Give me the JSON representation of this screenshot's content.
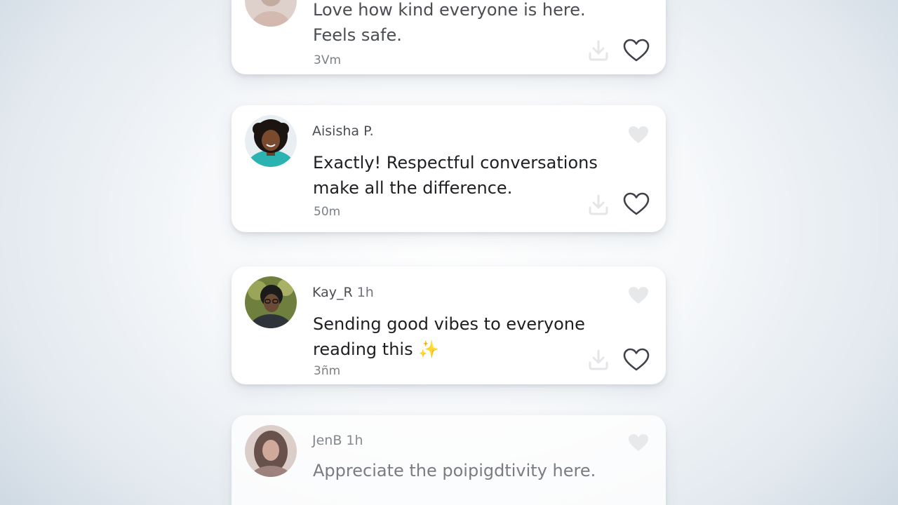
{
  "comments": [
    {
      "author": "",
      "time": "",
      "text": "Love how kind everyone is here.\nFeels safe.",
      "age": "3Vm"
    },
    {
      "author": "Aisisha P.",
      "time": "",
      "text": "Exactly! Respectful conversations\nmake all the difference.",
      "age": "50m"
    },
    {
      "author": "Kay_R",
      "time": "1h",
      "text": "Sending good vibes to everyone\nreading this ✨",
      "age": "3ñm"
    },
    {
      "author": "JenB",
      "time": "1h",
      "text": "Appreciate the poipigdtivity here.",
      "age": ""
    }
  ],
  "icons": {
    "like": "heart-outline-icon",
    "share": "download-icon",
    "ghost_like": "heart-icon"
  },
  "colors": {
    "heart_stroke": "#3f4349",
    "text_primary": "#1d1f22",
    "text_secondary": "#4a4d52",
    "sparkle": "#f2c94c"
  }
}
